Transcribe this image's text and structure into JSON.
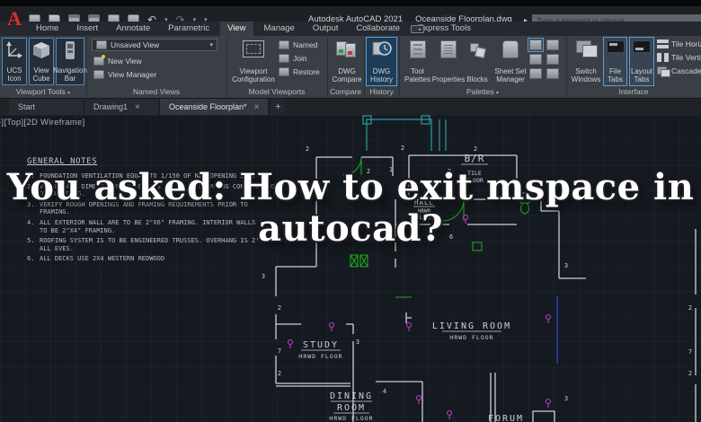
{
  "window": {
    "logo_letter": "A",
    "app_title": "Autodesk AutoCAD 2021",
    "doc_title": "Oceanside Floorplan.dwg",
    "search_placeholder": "Type a keyword or phrase"
  },
  "icons": {
    "undo": "↶",
    "redo": "↷",
    "caret_down": "▾",
    "caret_right": "▸"
  },
  "ribbon": {
    "tabs": [
      "Home",
      "Insert",
      "Annotate",
      "Parametric",
      "View",
      "Manage",
      "Output",
      "Collaborate",
      "Express Tools"
    ],
    "active_tab": "View",
    "viewport_tools": {
      "label": "Viewport Tools",
      "buttons": [
        "UCS Icon",
        "View Cube",
        "Navigation Bar"
      ]
    },
    "named_views": {
      "label": "Named Views",
      "dropdown": "Unsaved View",
      "items": [
        "New View",
        "View Manager"
      ]
    },
    "model_viewports": {
      "label": "Model Viewports",
      "main": "Viewport Configuration",
      "items": [
        "Named",
        "Join",
        "Restore"
      ]
    },
    "compare": {
      "label": "Compare",
      "button": "DWG Compare"
    },
    "history": {
      "label": "History",
      "button": "DWG History"
    },
    "palettes": {
      "label": "Palettes",
      "buttons": [
        "Tool Palettes",
        "Properties",
        "Blocks",
        "Sheet Set Manager"
      ]
    },
    "interface": {
      "label": "Interface",
      "buttons": [
        "Switch Windows",
        "File Tabs",
        "Layout Tabs"
      ],
      "items": [
        "Tile Horizontally",
        "Tile Vertically",
        "Cascade"
      ]
    }
  },
  "file_tabs": {
    "tabs": [
      "Start",
      "Drawing1",
      "Oceanside Floorplan*"
    ],
    "active": "Oceanside Floorplan*",
    "close": "×",
    "new_tab": "+"
  },
  "canvas": {
    "viewport_control": "[-][Top][2D Wireframe]",
    "notes": {
      "title": "GENERAL NOTES",
      "items": [
        {
          "num": "1.",
          "text": "FOUNDATION VENTILATION EQUAL TO 1/150 OF NET OPENING S.F."
        },
        {
          "num": "2.",
          "text": "VERIFY ALL DIMENSIONS AND GRADES PRIOR TO STARTING CONSTRUCTION OR BUILDING."
        },
        {
          "num": "3.",
          "text": "VERIFY ROUGH OPENINGS AND FRAMING REQUIREMENTS PRIOR TO FRAMING."
        },
        {
          "num": "4.",
          "text": "ALL EXTERIOR WALL ARE TO BE 2\"X6\" FRAMING. INTERIOR WALLS ARE TO BE 2\"X4\" FRAMING."
        },
        {
          "num": "5.",
          "text": "ROOFING SYSTEM IS TO BE ENGINEERED TRUSSES. OVERHANG IS 2'6\" AT ALL EVES."
        },
        {
          "num": "6.",
          "text": "ALL DECKS USE 2X4 WESTERN REDWOOD"
        }
      ]
    },
    "rooms": {
      "br": {
        "name": "B/R",
        "sub1": "TILE",
        "sub2": "FLOOR"
      },
      "hall": {
        "name": "HALL",
        "sub1": "HRWD",
        "sub2": "FLOOR"
      },
      "living": {
        "name": "LIVING ROOM",
        "sub": "HRWD FLOOR"
      },
      "study": {
        "name": "STUDY",
        "sub": "HRWD FLOOR"
      },
      "dining": {
        "name": "DINING",
        "name2": "ROOM",
        "sub": "HRWD FLOOR"
      },
      "forum": {
        "name": "FORUM"
      }
    },
    "numbers": [
      "2",
      "2",
      "2",
      "1",
      "2",
      "2",
      "6",
      "3",
      "3",
      "2",
      "7",
      "2",
      "3",
      "4",
      "3",
      "2",
      "7",
      "2"
    ]
  },
  "overlay": {
    "line1": "You asked: How to exit mspace in",
    "line2": "autocad?"
  },
  "colors": {
    "accent_blue": "#5b9bd3",
    "selection_bg": "#1d3c58",
    "wall": "#ccd0d5",
    "teal": "#2f9b9b",
    "green": "#1db21d",
    "magenta": "#c23ac2",
    "canvas_bg": "#151a21",
    "headline": "#ffffff"
  }
}
